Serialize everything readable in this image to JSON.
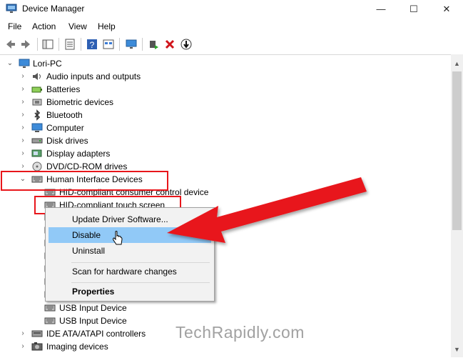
{
  "window": {
    "title": "Device Manager",
    "minimize": "—",
    "maximize": "☐",
    "close": "✕"
  },
  "menu": {
    "file": "File",
    "action": "Action",
    "view": "View",
    "help": "Help"
  },
  "tree": {
    "root": "Lori-PC",
    "categories": [
      "Audio inputs and outputs",
      "Batteries",
      "Biometric devices",
      "Bluetooth",
      "Computer",
      "Disk drives",
      "Display adapters",
      "DVD/CD-ROM drives",
      "Human Interface Devices"
    ],
    "hid_children": [
      "HID-compliant consumer control device",
      "HID-compliant touch screen",
      "USB Input Device",
      "USB Input Device"
    ],
    "after": [
      "IDE ATA/ATAPI controllers",
      "Imaging devices"
    ]
  },
  "context_menu": {
    "update": "Update Driver Software...",
    "disable": "Disable",
    "uninstall": "Uninstall",
    "scan": "Scan for hardware changes",
    "properties": "Properties"
  },
  "watermark": "TechRapidly.com",
  "colors": {
    "highlight_box": "#e8161b",
    "arrow": "#e8161b",
    "menu_highlight": "#91c9f7"
  }
}
